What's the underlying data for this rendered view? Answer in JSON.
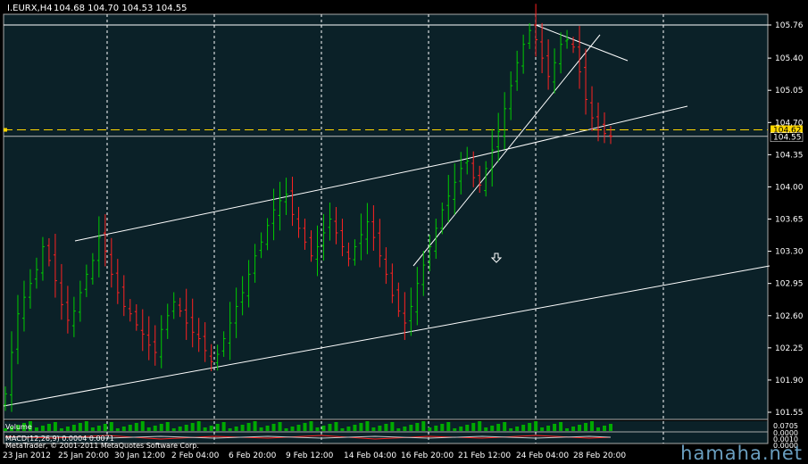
{
  "chart_data": {
    "type": "candlestick",
    "title": "I.EURX,H4  104.68 104.70 104.53 104.55",
    "symbol": "I.EURX,H4",
    "ohlc_header": "104.68 104.70 104.53 104.55",
    "ylim": [
      101.45,
      105.85
    ],
    "price_ticks": [
      "105.76",
      "105.40",
      "105.05",
      "104.70",
      "104.35",
      "104.00",
      "103.65",
      "103.30",
      "102.95",
      "102.60",
      "102.25",
      "101.90",
      "101.55"
    ],
    "current_price": 104.55,
    "current_price_label": "104.55",
    "level_price": 104.62,
    "level_label": "104.62",
    "x_labels": [
      "23 Jan 2012",
      "25 Jan 20:00",
      "30 Jan 12:00",
      "2 Feb 04:00",
      "6 Feb 20:00",
      "9 Feb 12:00",
      "14 Feb 04:00",
      "16 Feb 20:00",
      "21 Feb 12:00",
      "24 Feb 04:00",
      "28 Feb 20:00"
    ],
    "closes": [
      101.75,
      102.2,
      102.62,
      102.8,
      102.95,
      103.1,
      103.35,
      103.2,
      102.98,
      102.72,
      102.55,
      102.65,
      102.85,
      103.05,
      103.2,
      103.45,
      103.3,
      103.05,
      102.85,
      102.7,
      102.62,
      102.5,
      102.4,
      102.28,
      102.2,
      102.45,
      102.6,
      102.75,
      102.65,
      102.52,
      102.42,
      102.35,
      102.22,
      102.1,
      102.18,
      102.35,
      102.52,
      102.7,
      102.85,
      103.05,
      103.25,
      103.4,
      103.58,
      103.75,
      103.85,
      103.92,
      103.7,
      103.55,
      103.4,
      103.25,
      103.35,
      103.5,
      103.65,
      103.5,
      103.35,
      103.22,
      103.35,
      103.48,
      103.62,
      103.45,
      103.25,
      103.05,
      102.82,
      102.65,
      102.52,
      102.7,
      102.95,
      103.15,
      103.35,
      103.55,
      103.75,
      103.9,
      104.05,
      104.2,
      104.28,
      104.1,
      104.02,
      104.2,
      104.4,
      104.6,
      104.85,
      105.1,
      105.35,
      105.55,
      105.7,
      105.6,
      105.4,
      105.2,
      105.35,
      105.55,
      105.6,
      105.52,
      105.25,
      104.95,
      104.75,
      104.62,
      104.58,
      104.55
    ],
    "volume_label": "Volume",
    "macd_label": "MACD(12,26,9) 0.0004 0.0071",
    "footer_label": "MetaTrader, © 2001-2011 MetaQuotes Software Corp.",
    "sub_price_labels": [
      "0.0705",
      "0.0000",
      "0.0010",
      "0.0000"
    ],
    "colors": {
      "background": "#000000",
      "chart_bg": "#0b2128",
      "bull": "#00cc00",
      "bear": "#ff2222",
      "grid": "#ffffff",
      "level": "#ffd700",
      "current_box": "#ffd700",
      "lines": "#ffffff"
    }
  },
  "watermark": "hamaha.net"
}
